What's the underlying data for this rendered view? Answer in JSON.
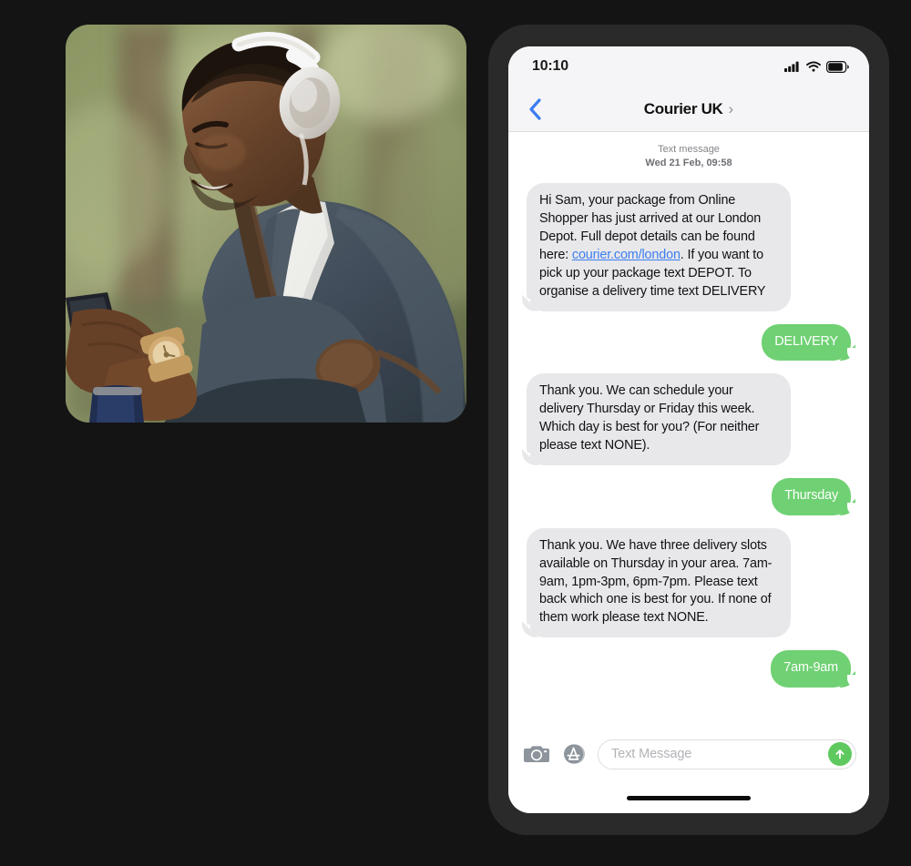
{
  "photo": {
    "alt": "Man wearing white over-ear headphones and a grey blazer smiling while looking at his phone outdoors",
    "icon": "photo-portrait"
  },
  "phone": {
    "status_bar": {
      "time": "10:10",
      "icons": [
        "cellular-signal-icon",
        "wifi-icon",
        "battery-icon"
      ]
    },
    "nav_bar": {
      "back_icon": "chevron-left-icon",
      "title": "Courier UK",
      "detail_icon": "chevron-right-icon",
      "detail_glyph": "›"
    },
    "conversation": {
      "timestamp_label": "Text message",
      "timestamp_date": "Wed 21 Feb, 09:58",
      "messages": [
        {
          "direction": "incoming",
          "text_before_link": "Hi Sam, your package from Online Shopper has just arrived at our London Depot. Full depot details can be found here: ",
          "link_text": "courier.com/london",
          "text_after_link": ". If you want to pick up your package text DEPOT. To organise a delivery time text DELIVERY"
        },
        {
          "direction": "outgoing",
          "text": "DELIVERY"
        },
        {
          "direction": "incoming",
          "text": "Thank you. We can schedule your delivery Thursday or Friday this week. Which day is best for you? (For neither please text NONE)."
        },
        {
          "direction": "outgoing",
          "text": "Thursday"
        },
        {
          "direction": "incoming",
          "text": "Thank you. We have three delivery slots available on Thursday in your area. 7am-9am, 1pm-3pm, 6pm-7pm. Please text back which one is best for you. If none of them work please text NONE."
        },
        {
          "direction": "outgoing",
          "text": "7am-9am"
        }
      ]
    },
    "input_bar": {
      "camera_icon": "camera-icon",
      "appstore_icon": "app-store-icon",
      "placeholder": "Text Message",
      "send_icon": "send-arrow-up-icon"
    },
    "home_indicator": "home-indicator"
  },
  "colors": {
    "page_background": "#141414",
    "phone_bezel": "#2a2a2a",
    "bubble_incoming": "#e8e8ea",
    "bubble_outgoing": "#6fd173",
    "link": "#3c7df0",
    "back_chevron": "#3c7df0",
    "send_button": "#5ec95e",
    "status_bar_bg": "#f5f5f7"
  }
}
